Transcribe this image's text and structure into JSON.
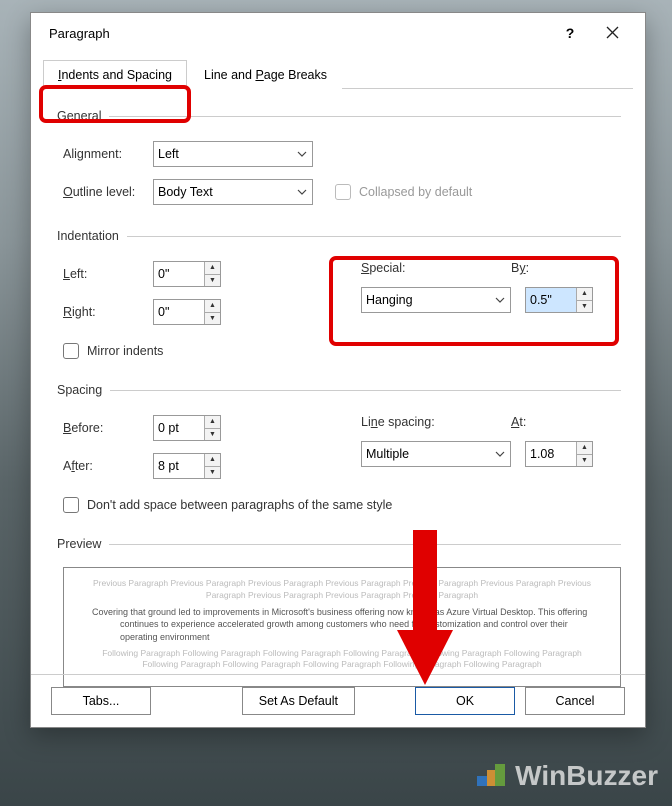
{
  "dialog": {
    "title": "Paragraph",
    "help": "?"
  },
  "tabs": {
    "active": "Indents and Spacing",
    "inactive": "Line and Page Breaks"
  },
  "general": {
    "legend": "General",
    "alignment_label": "Alignment:",
    "alignment_value": "Left",
    "outline_label": "Outline level:",
    "outline_value": "Body Text",
    "collapsed_label": "Collapsed by default"
  },
  "indentation": {
    "legend": "Indentation",
    "left_label": "Left:",
    "left_value": "0\"",
    "right_label": "Right:",
    "right_value": "0\"",
    "special_label": "Special:",
    "special_value": "Hanging",
    "by_label": "By:",
    "by_value": "0.5\"",
    "mirror_label": "Mirror indents"
  },
  "spacing": {
    "legend": "Spacing",
    "before_label": "Before:",
    "before_value": "0 pt",
    "after_label": "After:",
    "after_value": "8 pt",
    "line_label": "Line spacing:",
    "line_value": "Multiple",
    "at_label": "At:",
    "at_value": "1.08",
    "dont_add_label": "Don't add space between paragraphs of the same style"
  },
  "preview": {
    "legend": "Preview",
    "prev_text": "Previous Paragraph Previous Paragraph Previous Paragraph Previous Paragraph Previous Paragraph Previous Paragraph Previous Paragraph Previous Paragraph Previous Paragraph Previous Paragraph",
    "sample_text": "Covering that ground led to improvements in Microsoft's business offering now known as Azure Virtual Desktop. This offering continues to experience accelerated growth among customers who need full customization and control over their operating environment",
    "next_text": "Following Paragraph Following Paragraph Following Paragraph Following Paragraph Following Paragraph Following Paragraph Following Paragraph Following Paragraph Following Paragraph Following Paragraph Following Paragraph"
  },
  "buttons": {
    "tabs": "Tabs...",
    "default": "Set As Default",
    "ok": "OK",
    "cancel": "Cancel"
  },
  "watermark": "WinBuzzer"
}
